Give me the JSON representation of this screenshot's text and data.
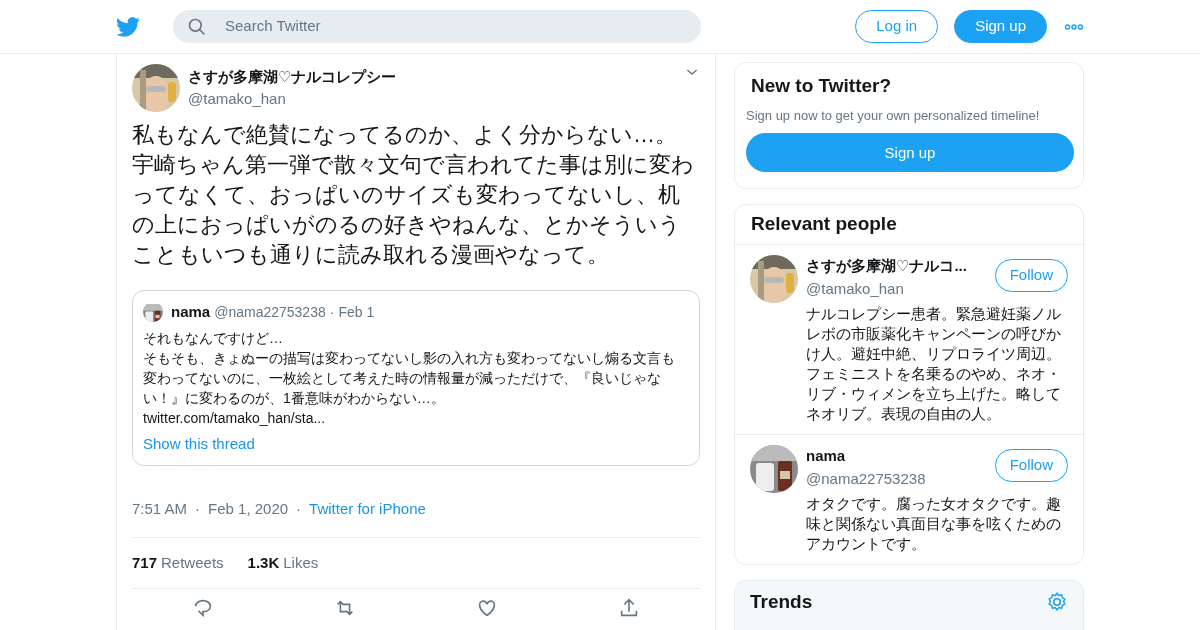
{
  "header": {
    "search": {
      "placeholder": "Search Twitter"
    },
    "login": "Log in",
    "signup": "Sign up"
  },
  "tweet": {
    "author": {
      "name": "さすが多摩湖♡ナルコレプシー",
      "handle": "@tamako_han"
    },
    "text": [
      "私もなんで絶賛になってるのか、よく分からない…。",
      "宇崎ちゃん第一弾で散々文句で言われてた事は別に変わってなくて、おっぱいのサイズも変わってないし、机の上におっぱいがのるの好きやねんな、とかそういうこともいつも通りに読み取れる漫画やなって。"
    ],
    "quote": {
      "name": "nama",
      "handle": "@nama22753238",
      "date_separator": "·",
      "date": "Feb 1",
      "text": [
        "それもなんですけど…",
        "そもそも、きょぬーの描写は変わってないし影の入れ方も変わってないし煽る文言も変わってないのに、一枚絵として考えた時の情報量が減っただけで、『良いじゃない！』に変わるのが、1番意味がわからない…。"
      ],
      "link": "twitter.com/tamako_han/sta...",
      "thread": "Show this thread"
    },
    "time": "7:51 AM",
    "separator_1": "·",
    "date": "Feb 1, 2020",
    "separator_2": "·",
    "source": "Twitter for iPhone",
    "stats": [
      {
        "count": "717",
        "label": "Retweets"
      },
      {
        "count": "1.3K",
        "label": "Likes"
      }
    ]
  },
  "sidebar": {
    "new": {
      "title": "New to Twitter?",
      "text": "Sign up now to get your own personalized timeline!",
      "button": "Sign up"
    },
    "people": {
      "title": "Relevant people",
      "items": [
        {
          "name": "さすが多摩湖♡ナルコ...",
          "handle": "@tamako_han",
          "follow": "Follow",
          "bio": "ナルコレプシー患者。緊急避妊薬ノルレボの市販薬化キャンペーンの呼びかけ人。避妊中絶、リプロライツ周辺。フェミニストを名乗るのやめ、ネオ・リブ・ウィメンを立ち上げた。略してネオリブ。表現の自由の人。"
        },
        {
          "name": "nama",
          "handle": "@nama22753238",
          "follow": "Follow",
          "bio": "オタクです。腐った女オタクです。趣味と関係ない真面目な事を呟くためのアカウントです。"
        }
      ]
    },
    "trends": {
      "title": "Trends"
    }
  }
}
